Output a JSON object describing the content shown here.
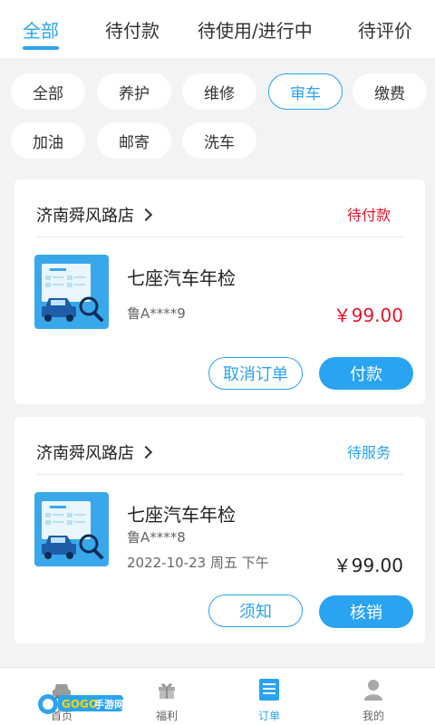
{
  "top_tabs": [
    {
      "label": "全部",
      "active": true
    },
    {
      "label": "待付款",
      "active": false
    },
    {
      "label": "待使用/进行中",
      "active": false
    },
    {
      "label": "待评价",
      "active": false
    }
  ],
  "filters": [
    {
      "label": "全部",
      "active": false
    },
    {
      "label": "养护",
      "active": false
    },
    {
      "label": "维修",
      "active": false
    },
    {
      "label": "审车",
      "active": true
    },
    {
      "label": "缴费",
      "active": false
    },
    {
      "label": "加油",
      "active": false
    },
    {
      "label": "邮寄",
      "active": false
    },
    {
      "label": "洗车",
      "active": false
    }
  ],
  "orders": [
    {
      "store": "济南舜风路店",
      "status": "待付款",
      "status_color": "#e0162b",
      "product": "七座汽车年检",
      "plate": "鲁A****9",
      "price": "￥99.00",
      "price_color": "#e0162b",
      "buttons": [
        "取消订单",
        "付款"
      ],
      "icon": "car-inspection-icon"
    },
    {
      "store": "济南舜风路店",
      "status": "待服务",
      "status_color": "#2aa3f0",
      "product": "七座汽车年检",
      "plate": "鲁A****8",
      "time": "2022-10-23 周五 下午",
      "price": "￥99.00",
      "price_color": "#222222",
      "buttons": [
        "须知",
        "核销"
      ],
      "icon": "car-inspection-icon"
    }
  ],
  "bottom_nav": [
    {
      "label": "首页",
      "icon": "car-icon",
      "active": false
    },
    {
      "label": "福利",
      "icon": "gift-icon",
      "active": false
    },
    {
      "label": "订单",
      "icon": "order-list-icon",
      "active": true
    },
    {
      "label": "我的",
      "icon": "user-icon",
      "active": false
    }
  ],
  "watermark": {
    "text": "GOGO手游网"
  },
  "colors": {
    "accent": "#2aa3f0",
    "danger": "#e0162b",
    "background": "#f2f3f5"
  }
}
